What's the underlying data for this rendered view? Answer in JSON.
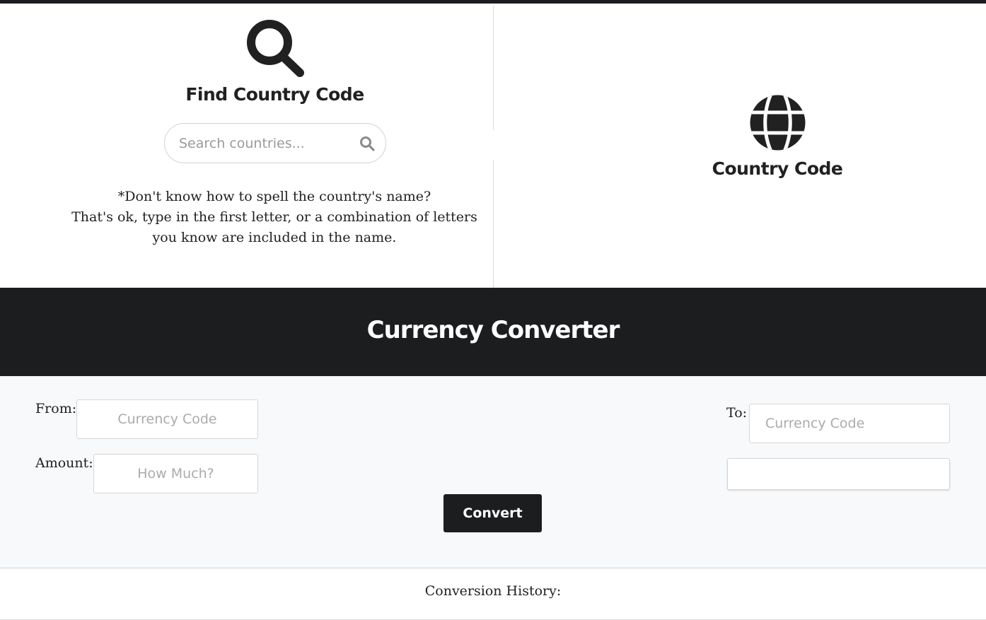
{
  "finder": {
    "title": "Find Country Code",
    "search_placeholder": "Search countries...",
    "search_value": "",
    "hint_line1": "*Don't know how to spell the country's name?",
    "hint_line2": "That's ok, type in the first letter, or a combination of letters you know are included in the name.",
    "title_icon": "magnifier-icon",
    "search_icon": "search-icon"
  },
  "country_code": {
    "title": "Country Code",
    "icon": "globe-icon"
  },
  "converter": {
    "title": "Currency Converter",
    "from_label": "From:",
    "from_placeholder": "Currency Code",
    "amount_label": "Amount:",
    "amount_placeholder": "How Much?",
    "to_label": "To:",
    "to_placeholder": "Currency Code",
    "result_value": "",
    "convert_label": "Convert"
  },
  "history": {
    "label": "Conversion History:"
  },
  "colors": {
    "dark": "#1c1d1f",
    "text": "#212121",
    "form_bg": "#f8f9fa",
    "border": "#d6d6d6"
  }
}
